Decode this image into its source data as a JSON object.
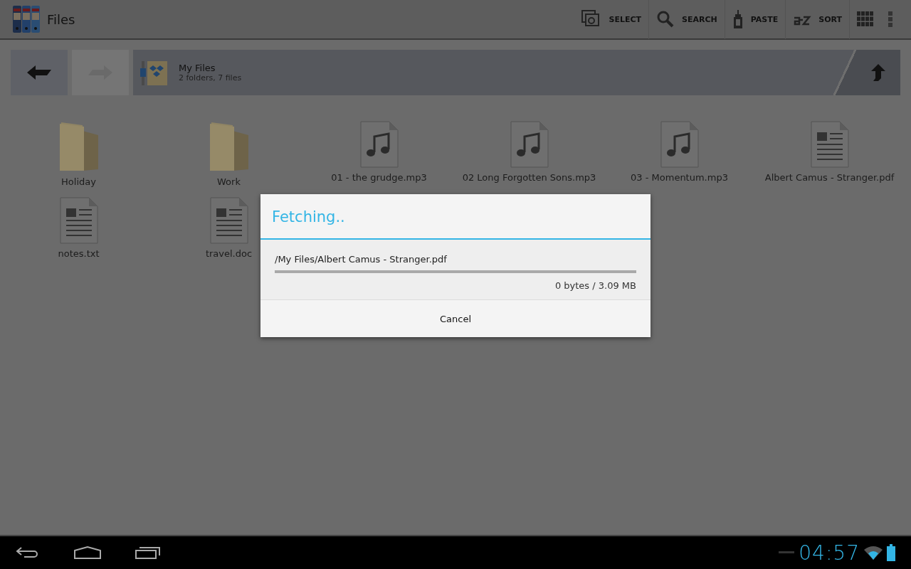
{
  "app_bar": {
    "title": "Files",
    "actions": [
      {
        "kind": "select",
        "label": "SELECT"
      },
      {
        "kind": "search",
        "label": "SEARCH"
      },
      {
        "kind": "paste",
        "label": "PASTE"
      },
      {
        "kind": "sort",
        "label": "SORT"
      },
      {
        "kind": "grid"
      },
      {
        "kind": "overflow"
      }
    ]
  },
  "path_bar": {
    "back_disabled": false,
    "forward_disabled": true,
    "title": "My Files",
    "subtitle": "2 folders, 7 files"
  },
  "files": [
    {
      "kind": "folder",
      "name": "Holiday"
    },
    {
      "kind": "folder",
      "name": "Work"
    },
    {
      "kind": "audio",
      "name": "01 - the grudge.mp3"
    },
    {
      "kind": "audio",
      "name": "02 Long Forgotten Sons.mp3"
    },
    {
      "kind": "audio",
      "name": "03 - Momentum.mp3"
    },
    {
      "kind": "document",
      "name": "Albert Camus - Stranger.pdf"
    },
    {
      "kind": "document",
      "name": "notes.txt"
    },
    {
      "kind": "document",
      "name": "travel.doc"
    }
  ],
  "dialog": {
    "title": "Fetching..",
    "path": "/My Files/Albert Camus - Stranger.pdf",
    "level": 0,
    "progress": "0 bytes / 3.09 MB",
    "button": "Cancel"
  },
  "nav_bar": {
    "time": "04:57"
  }
}
